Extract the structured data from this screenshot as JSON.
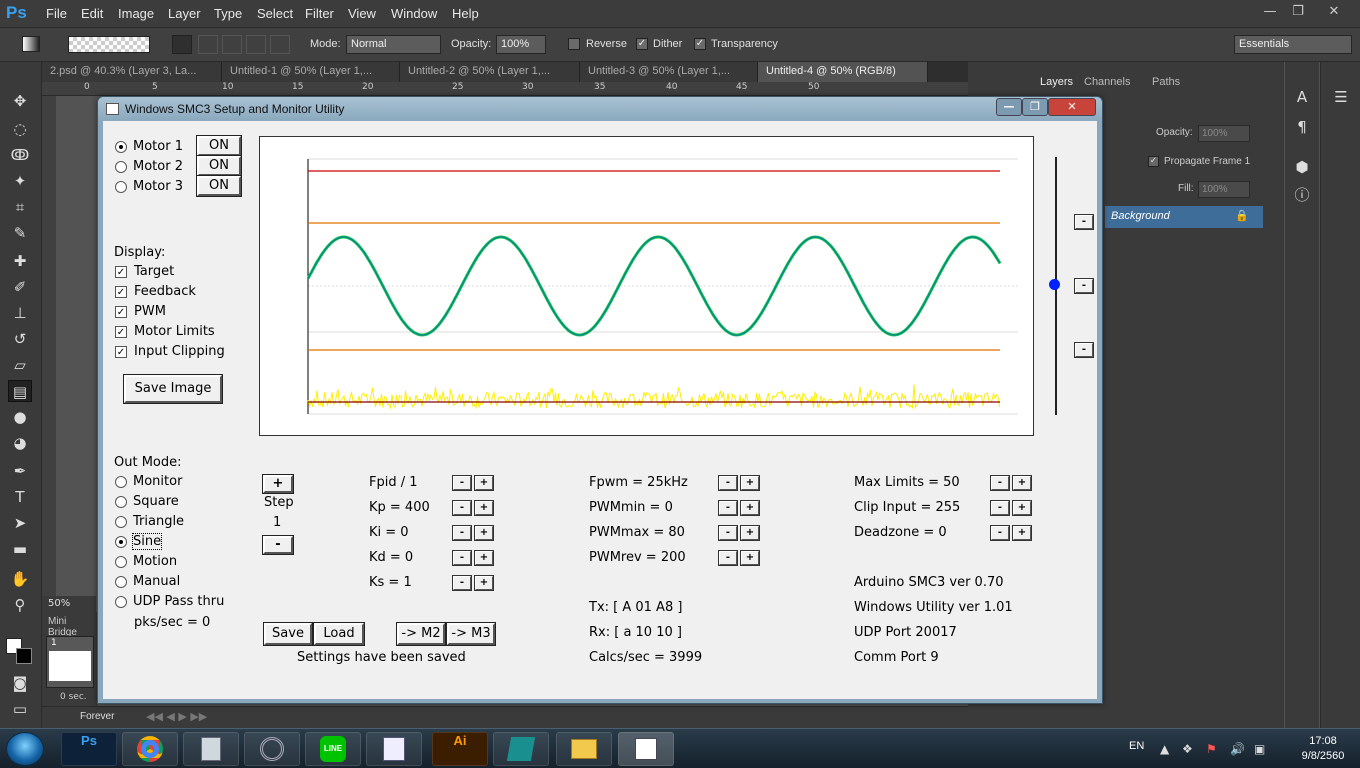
{
  "ps": {
    "logo": "Ps",
    "menu": [
      "File",
      "Edit",
      "Image",
      "Layer",
      "Type",
      "Select",
      "Filter",
      "View",
      "Window",
      "Help"
    ],
    "window_controls": {
      "minimize": "—",
      "restore": "❐",
      "close": "✕"
    },
    "options": {
      "mode_label": "Mode:",
      "mode_value": "Normal",
      "opacity_label": "Opacity:",
      "opacity_value": "100%",
      "reverse": "Reverse",
      "dither": "Dither",
      "transparency": "Transparency",
      "workspace": "Essentials"
    },
    "tabs": [
      "2.psd @ 40.3% (Layer 3, La...",
      "Untitled-1 @ 50% (Layer 1,...",
      "Untitled-2 @ 50% (Layer 1,...",
      "Untitled-3 @ 50% (Layer 1,...",
      "Untitled-4 @ 50% (RGB/8)"
    ],
    "ruler": [
      "0",
      "5",
      "10",
      "15",
      "20",
      "25",
      "30",
      "35",
      "40",
      "45",
      "50"
    ],
    "zoom": "50%",
    "mini_bridge": "Mini Bridge",
    "frame_number": "1",
    "frame_time": "0 sec.",
    "loop": "Forever",
    "layers_tabs": [
      "Layers",
      "Channels",
      "Paths"
    ],
    "layers_opacity_label": "Opacity:",
    "layers_opacity_value": "100%",
    "propagate": "Propagate Frame 1",
    "fill_label": "Fill:",
    "fill_value": "100%",
    "layer_name": "Background"
  },
  "taskbar": {
    "lang": "EN",
    "time": "17:08",
    "date": "9/8/2560",
    "apps": [
      "Ps",
      "Chrome",
      "Calculator",
      "Media",
      "LINE",
      "Document",
      "Ai",
      "3ds Max",
      "Explorer",
      "SMC3"
    ]
  },
  "smc": {
    "title": "Windows SMC3 Setup and Monitor Utility",
    "motors": [
      {
        "label": "Motor 1",
        "state": "ON",
        "selected": true
      },
      {
        "label": "Motor 2",
        "state": "ON",
        "selected": false
      },
      {
        "label": "Motor 3",
        "state": "ON",
        "selected": false
      }
    ],
    "display_label": "Display:",
    "display": [
      "Target",
      "Feedback",
      "PWM",
      "Motor Limits",
      "Input Clipping"
    ],
    "save_image": "Save Image",
    "out_mode_label": "Out Mode:",
    "out_modes": [
      "Monitor",
      "Square",
      "Triangle",
      "Sine",
      "Motion",
      "Manual",
      "UDP Pass thru"
    ],
    "out_mode_selected": 3,
    "pks": "pks/sec = 0",
    "step_label": "Step",
    "step_value": "1",
    "plus": "+",
    "minus": "-",
    "pid": [
      "Fpid / 1",
      "Kp = 400",
      "Ki = 0",
      "Kd = 0",
      "Ks = 1"
    ],
    "pwm": [
      "Fpwm = 25kHz",
      "PWMmin = 0",
      "PWMmax = 80",
      "PWMrev = 200"
    ],
    "limits": [
      "Max Limits = 50",
      "Clip Input = 255",
      "Deadzone = 0"
    ],
    "tx": "Tx: [ A 01 A8 ]",
    "rx": "Rx: [ a 10 10 ]",
    "calcs": "Calcs/sec = 3999",
    "info": [
      "Arduino SMC3 ver 0.70",
      "Windows Utility ver 1.01",
      "UDP Port 20017",
      "Comm Port 9"
    ],
    "buttons": {
      "save": "Save",
      "load": "Load",
      "m2": "-> M2",
      "m3": "-> M3"
    },
    "status": "Settings have been saved"
  },
  "chart_data": {
    "type": "line",
    "series": [
      {
        "values_kind": "sine",
        "cycles": 4.4,
        "amplitude": 0.49,
        "color": "#0b8a8a"
      },
      {
        "values_kind": "noise",
        "color": "#ffee00"
      }
    ],
    "lines_colors": {
      "upper_limit": "#cc0000",
      "clip": "#e07000",
      "baseline": "#8b0000"
    }
  }
}
